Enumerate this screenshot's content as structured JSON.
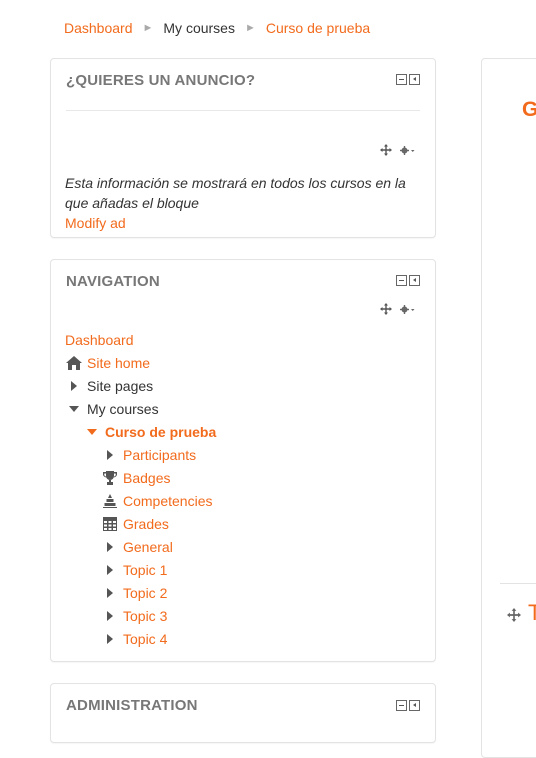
{
  "breadcrumb": {
    "items": [
      {
        "label": "Dashboard",
        "link": true
      },
      {
        "label": "My courses",
        "link": false
      },
      {
        "label": "Curso de prueba",
        "link": true
      }
    ],
    "separator": "►"
  },
  "ad_block": {
    "title": "¿QUIERES UN ANUNCIO?",
    "text": "Esta información se mostrará en todos los cursos en la que añadas el bloque",
    "link_label": "Modify ad"
  },
  "navigation_block": {
    "title": "NAVIGATION",
    "items": [
      {
        "label": "Dashboard",
        "icon": "none",
        "style": "link"
      },
      {
        "label": "Site home",
        "icon": "home-icon",
        "style": "link"
      },
      {
        "label": "Site pages",
        "icon": "expand-right-icon",
        "style": "plain"
      },
      {
        "label": "My courses",
        "icon": "collapse-down-icon",
        "style": "plain"
      },
      {
        "label": "Curso de prueba",
        "icon": "collapse-down-icon",
        "style": "bold"
      },
      {
        "label": "Participants",
        "icon": "expand-right-icon",
        "style": "link"
      },
      {
        "label": "Badges",
        "icon": "trophy-icon",
        "style": "link"
      },
      {
        "label": "Competencies",
        "icon": "competencies-icon",
        "style": "link"
      },
      {
        "label": "Grades",
        "icon": "grades-table-icon",
        "style": "link"
      },
      {
        "label": "General",
        "icon": "expand-right-icon",
        "style": "link"
      },
      {
        "label": "Topic 1",
        "icon": "expand-right-icon",
        "style": "link"
      },
      {
        "label": "Topic 2",
        "icon": "expand-right-icon",
        "style": "link"
      },
      {
        "label": "Topic 3",
        "icon": "expand-right-icon",
        "style": "link"
      },
      {
        "label": "Topic 4",
        "icon": "expand-right-icon",
        "style": "link"
      }
    ]
  },
  "admin_block": {
    "title": "ADMINISTRATION"
  },
  "main_panel": {
    "heading_fragment": "G",
    "topic_fragment": "T"
  },
  "colors": {
    "accent": "#f26b1d",
    "text": "#333333",
    "block_title": "#777777",
    "border": "#e3e3e3"
  }
}
